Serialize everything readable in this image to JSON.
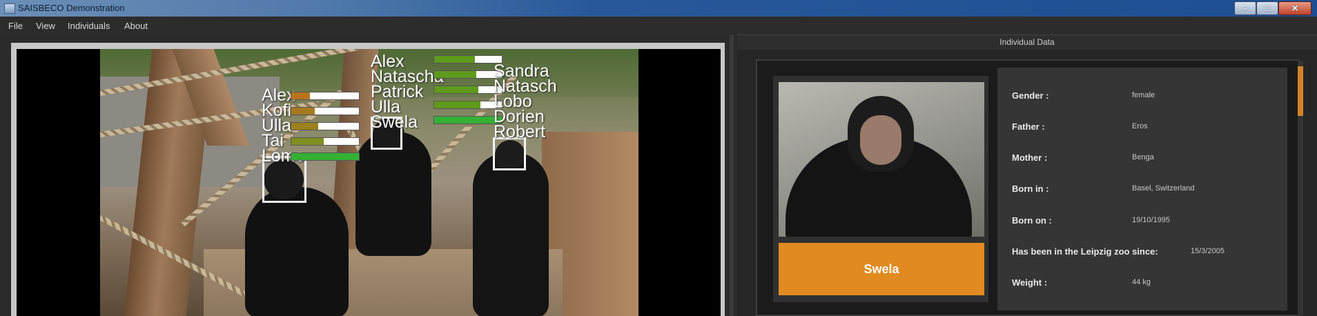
{
  "window": {
    "title": "SAISBECO Demonstration"
  },
  "menu": {
    "items": [
      "File",
      "View",
      "Individuals",
      "About"
    ]
  },
  "video": {
    "overlays": [
      {
        "labels": [
          "Alex",
          "Kofi",
          "Ulla",
          "Tai",
          "Lome"
        ],
        "scores": [
          0.28,
          0.35,
          0.4,
          0.48,
          1.0
        ],
        "colors": [
          "#b8731c",
          "#a7791f",
          "#9d801f",
          "#7f8f21",
          "#34b034"
        ]
      },
      {
        "labels": [
          "Alex",
          "Natascha",
          "Patrick",
          "Ulla",
          "Swela"
        ],
        "scores": [
          0.6,
          0.62,
          0.65,
          0.68,
          1.0
        ],
        "colors": [
          "#5f9a1c",
          "#5f9a1c",
          "#5f9a1c",
          "#5f9a1c",
          "#34b034"
        ]
      },
      {
        "labels": [
          "Sandra",
          "Natasch",
          "Lobo",
          "Dorien",
          "Robert"
        ]
      }
    ]
  },
  "panel": {
    "title": "Individual Data",
    "name": "Swela",
    "fields": [
      {
        "label": "Gender :",
        "value": "female"
      },
      {
        "label": "Father :",
        "value": "Eros"
      },
      {
        "label": "Mother :",
        "value": "Benga"
      },
      {
        "label": "Born in :",
        "value": "Basel, Switzerland"
      },
      {
        "label": "Born on :",
        "value": "19/10/1995"
      },
      {
        "label": "Has been in the Leipzig zoo since:",
        "value": "15/3/2005"
      },
      {
        "label": "Weight :",
        "value": "44 kg"
      }
    ]
  },
  "colors": {
    "accent": "#e08a20",
    "scroll_thumb": "#d2822a"
  }
}
